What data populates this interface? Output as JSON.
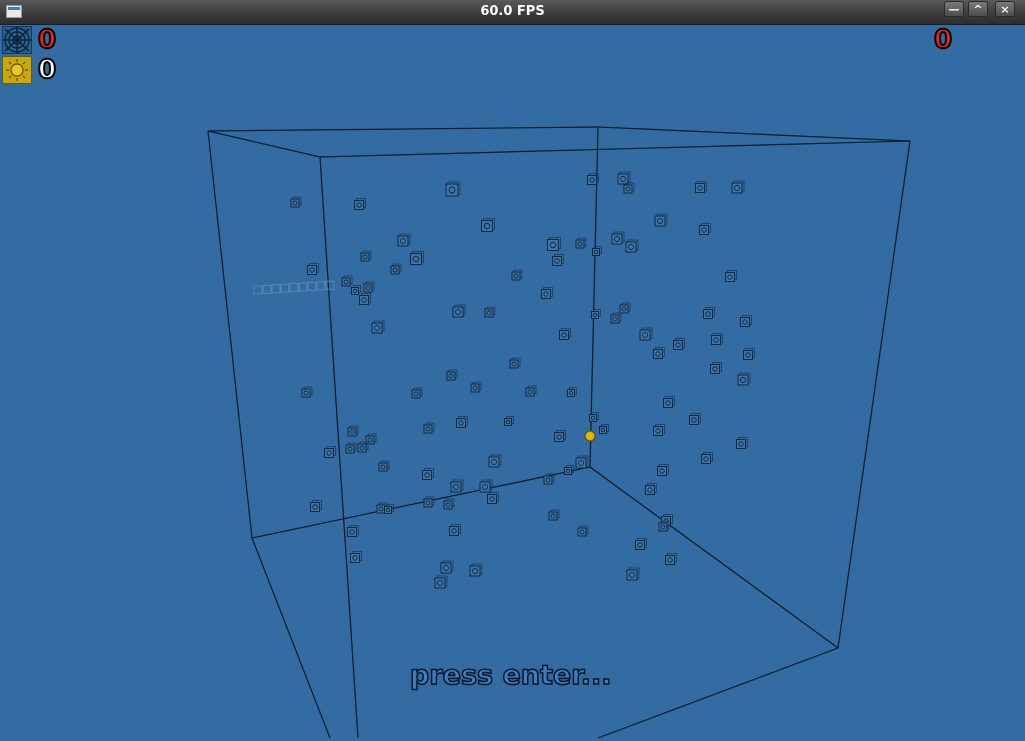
{
  "window": {
    "title": "60.0 FPS",
    "buttons": {
      "minimize": "—",
      "maximize": "^",
      "close": "×"
    }
  },
  "hud": {
    "web_score": "0",
    "sun_score": "0",
    "right_score": "0"
  },
  "prompt": "press enter...",
  "colors": {
    "background": "#336ca2",
    "cube_edge": "#0d1a26",
    "hud_red": "#ff1a1a",
    "player_yellow": "#e0b400"
  },
  "icons": {
    "web": "spiderweb-icon",
    "sun": "sun-icon"
  }
}
